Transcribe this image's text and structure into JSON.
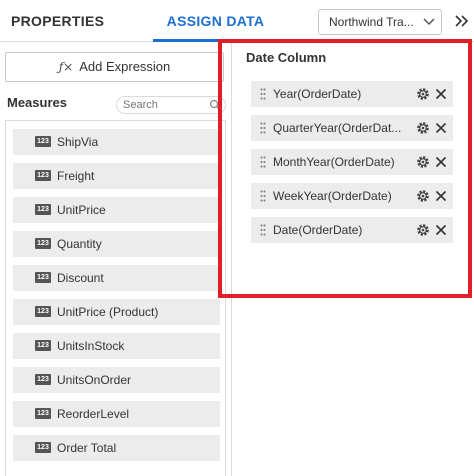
{
  "header": {
    "tabs": [
      {
        "label": "PROPERTIES",
        "active": false
      },
      {
        "label": "ASSIGN DATA",
        "active": true
      }
    ],
    "datasource_selected": "Northwind Tra..."
  },
  "left_panel": {
    "add_expression_label": "Add Expression",
    "measures_title": "Measures",
    "search_placeholder": "Search",
    "measures": [
      {
        "badge": "123",
        "label": "ShipVia"
      },
      {
        "badge": "123",
        "label": "Freight"
      },
      {
        "badge": "123",
        "label": "UnitPrice"
      },
      {
        "badge": "123",
        "label": "Quantity"
      },
      {
        "badge": "123",
        "label": "Discount"
      },
      {
        "badge": "123",
        "label": "UnitPrice (Product)"
      },
      {
        "badge": "123",
        "label": "UnitsInStock"
      },
      {
        "badge": "123",
        "label": "UnitsOnOrder"
      },
      {
        "badge": "123",
        "label": "ReorderLevel"
      },
      {
        "badge": "123",
        "label": "Order Total"
      }
    ]
  },
  "right_panel": {
    "title": "Date Column",
    "items": [
      {
        "label": "Year(OrderDate)"
      },
      {
        "label": "QuarterYear(OrderDat..."
      },
      {
        "label": "MonthYear(OrderDate)"
      },
      {
        "label": "WeekYear(OrderDate)"
      },
      {
        "label": "Date(OrderDate)"
      }
    ]
  },
  "colors": {
    "accent": "#1a6fd1",
    "highlight_border": "#e01f26",
    "item_background": "#ececec"
  },
  "icons": [
    "fx-icon",
    "chevron-down-icon",
    "double-chevron-right-icon",
    "search-icon",
    "number-badge-icon",
    "drag-handle-icon",
    "gear-icon",
    "close-icon"
  ]
}
